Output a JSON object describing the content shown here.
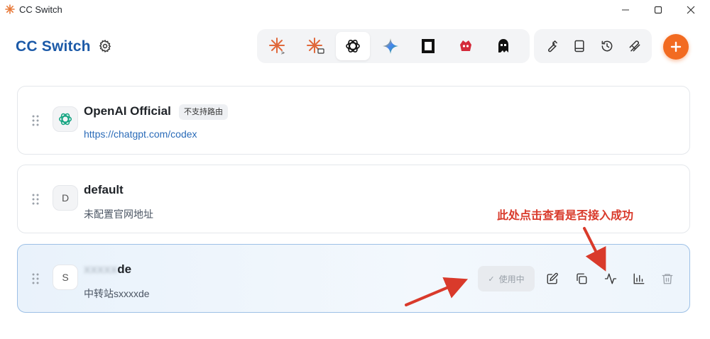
{
  "window": {
    "title": "CC Switch",
    "app_icon": "sunburst-icon",
    "controls": [
      "minimize-icon",
      "maximize-icon",
      "close-icon"
    ]
  },
  "header": {
    "brand": "CC Switch",
    "brand_color": "#1c5aa8",
    "settings_icon": "gear-icon",
    "app_tabs": [
      {
        "name": "claude-code-icon",
        "active": false
      },
      {
        "name": "claude-desktop-icon",
        "active": false
      },
      {
        "name": "openai-codex-icon",
        "active": true
      },
      {
        "name": "gemini-icon",
        "active": false
      },
      {
        "name": "opencode-icon",
        "active": false
      },
      {
        "name": "red-mascot-icon",
        "active": false
      },
      {
        "name": "ghost-mascot-icon",
        "active": false
      }
    ],
    "tools": [
      "wrench-icon",
      "book-icon",
      "history-icon",
      "prompts-icon"
    ],
    "add_button_icon": "plus-icon",
    "accent_color": "#f26b21"
  },
  "providers": [
    {
      "avatar": "openai-logo",
      "name": "OpenAI Official",
      "badge": "不支持路由",
      "url": "https://chatgpt.com/codex",
      "active": false
    },
    {
      "avatar_letter": "D",
      "name": "default",
      "desc": "未配置官网地址",
      "active": false
    },
    {
      "avatar_letter": "S",
      "name": "sxxxxde",
      "name_visible": "de",
      "desc": "中转站sxxxxde",
      "active": true
    }
  ],
  "actions": {
    "in_use_label": "使用中",
    "icons": [
      "edit-icon",
      "copy-icon",
      "test-latency-icon",
      "stats-icon",
      "trash-icon"
    ]
  },
  "annotation": {
    "text": "此处点击查看是否接入成功",
    "color": "#d93a2b"
  }
}
